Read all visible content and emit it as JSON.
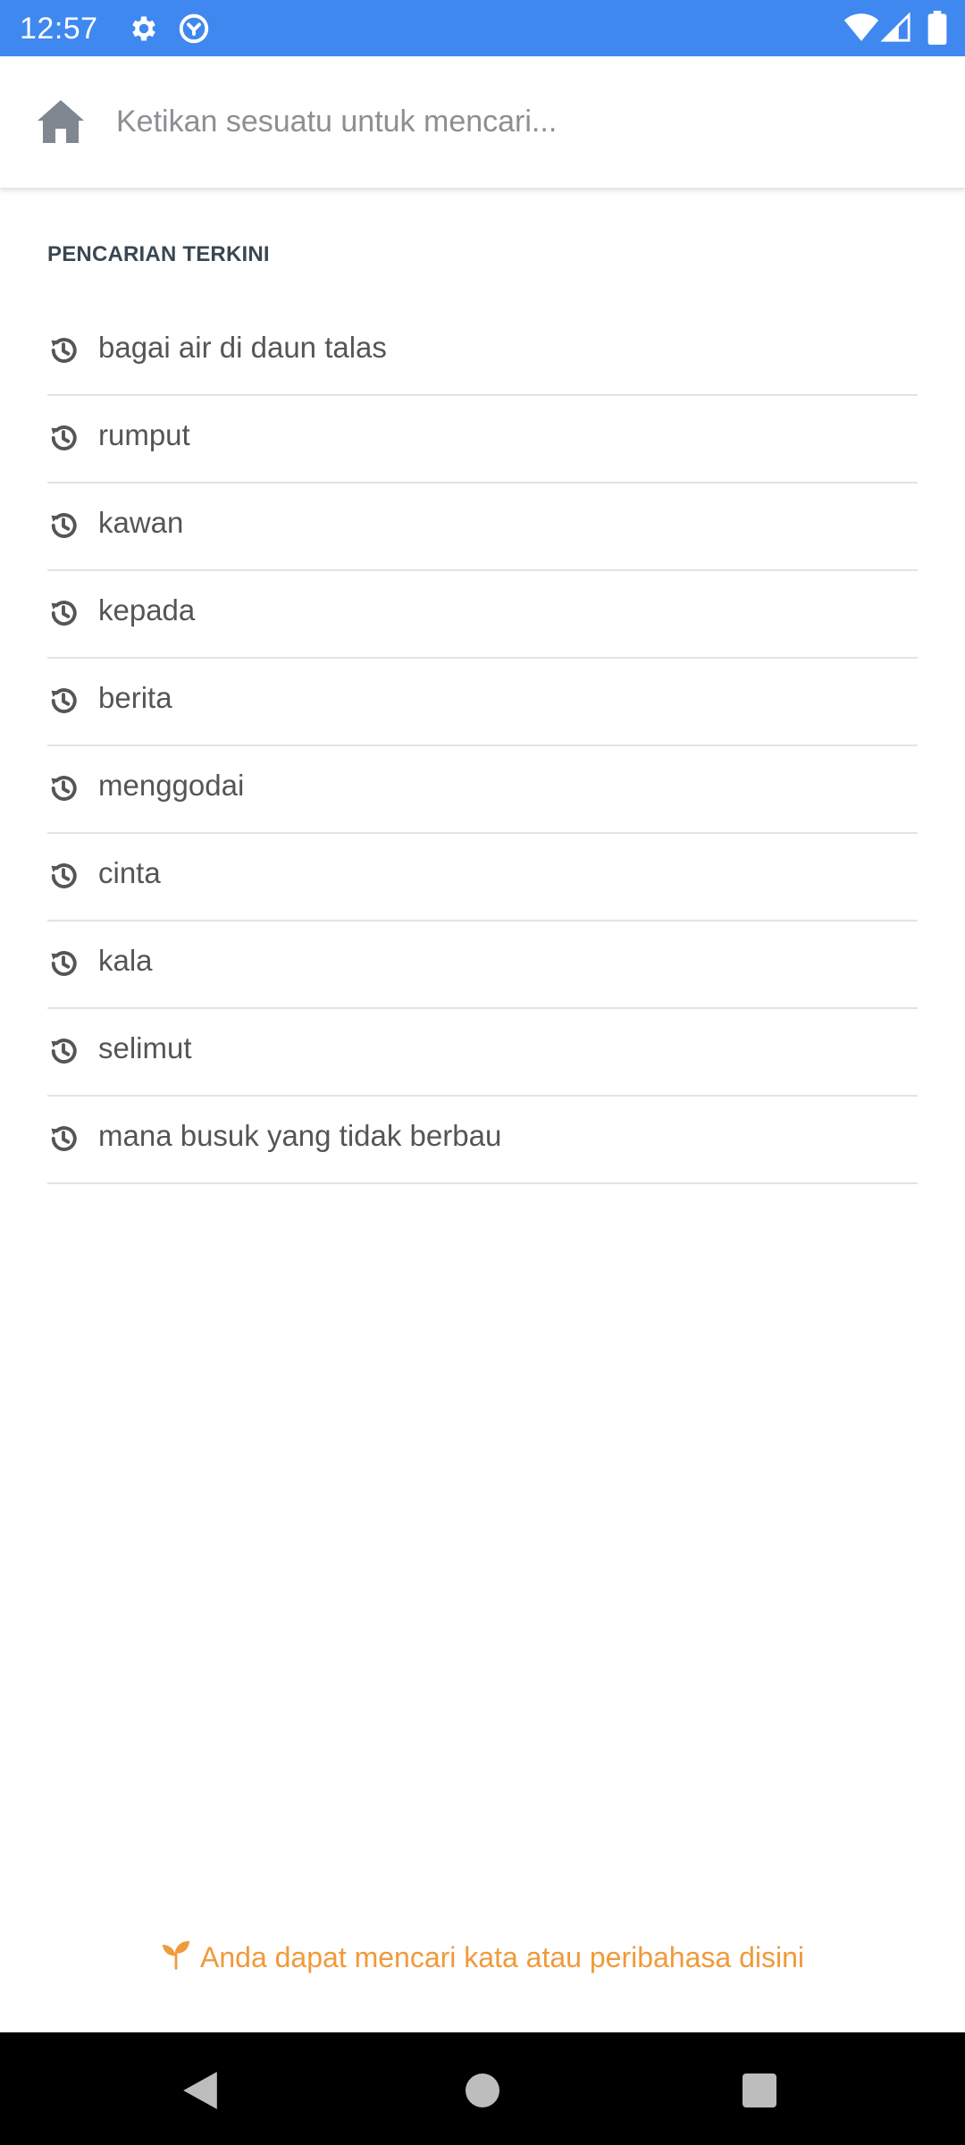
{
  "status_bar": {
    "time": "12:57",
    "icons": [
      "gear-icon",
      "sync-icon",
      "wifi-icon",
      "signal-icon",
      "battery-icon"
    ],
    "background": "#3f88f0"
  },
  "search": {
    "placeholder": "Ketikan sesuatu untuk mencari...",
    "value": ""
  },
  "recent": {
    "title": "PENCARIAN TERKINI",
    "items": [
      "bagai air di daun talas",
      "rumput",
      "kawan",
      "kepada",
      "berita",
      "menggodai",
      "cinta",
      "kala",
      "selimut",
      "mana busuk yang tidak berbau"
    ]
  },
  "footer": {
    "hint": "Anda dapat mencari kata atau peribahasa disini",
    "hint_color": "#f09a3a"
  },
  "nav_bar": {
    "buttons": [
      "back-icon",
      "home-circle-icon",
      "recents-square-icon"
    ]
  }
}
